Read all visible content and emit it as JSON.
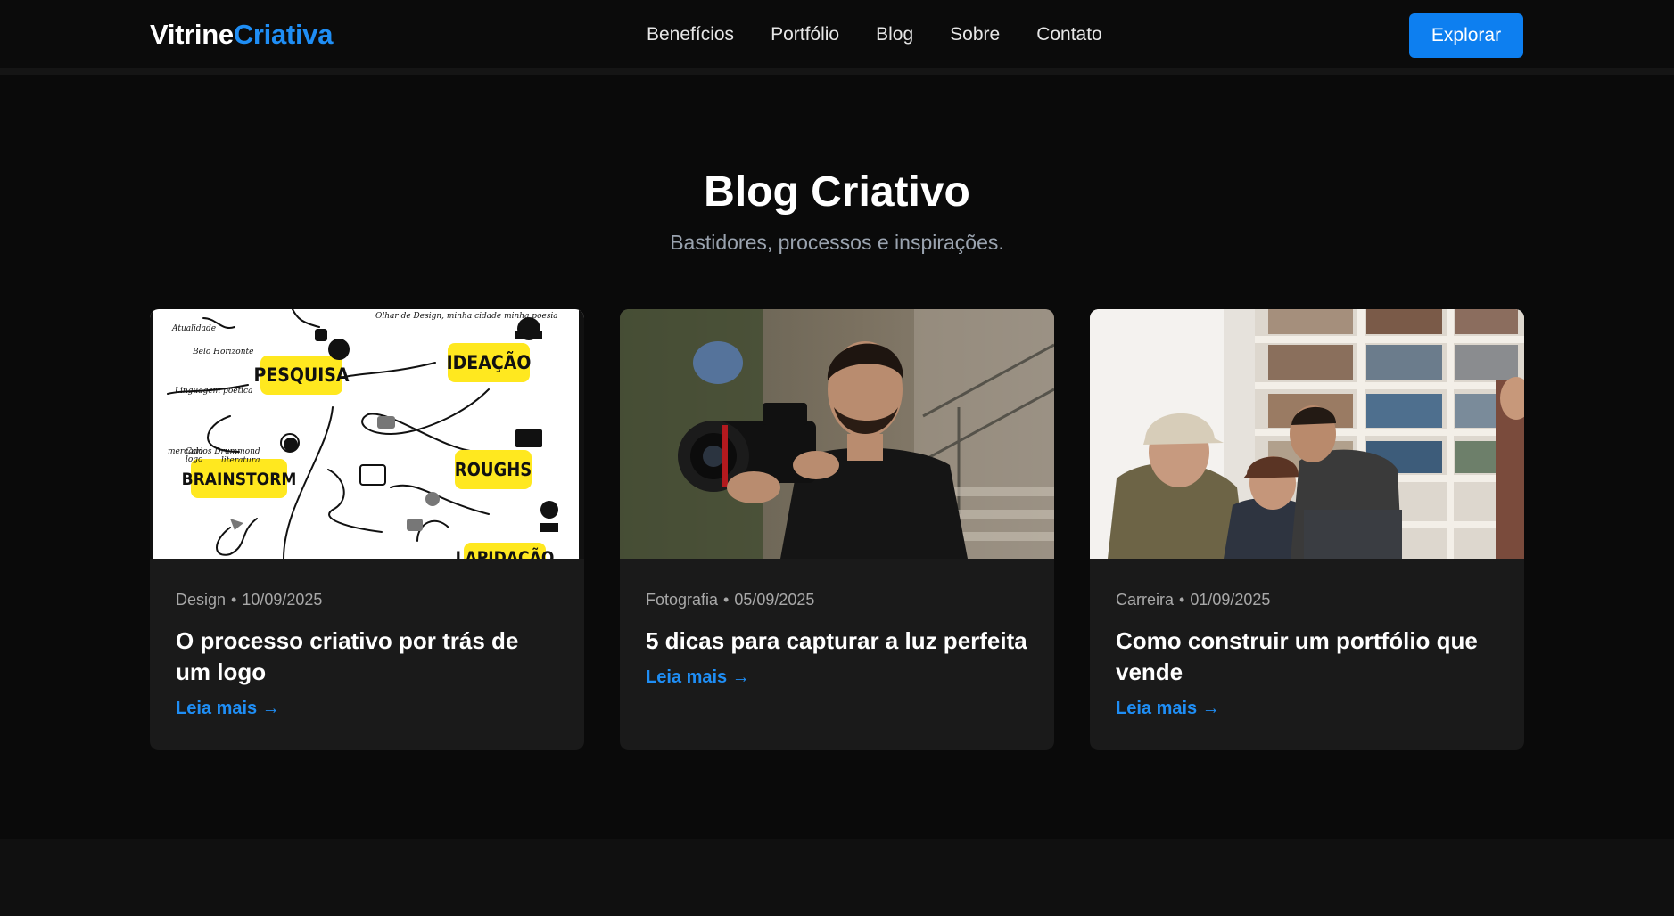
{
  "brand": {
    "part1": "Vitrine",
    "part2": "Criativa"
  },
  "nav": {
    "links": [
      "Benefícios",
      "Portfólio",
      "Blog",
      "Sobre",
      "Contato"
    ],
    "cta": "Explorar"
  },
  "blog": {
    "title": "Blog Criativo",
    "subtitle": "Bastidores, processos e inspirações.",
    "read_more": "Leia mais →",
    "separator": "•",
    "posts": [
      {
        "category": "Design",
        "date": "10/09/2025",
        "title": "O processo criativo por trás de um logo",
        "image_labels": [
          "PESQUISA",
          "IDEAÇÃO",
          "BRAINSTORM",
          "ROUGHS",
          "LAPIDAÇÃO"
        ],
        "image_notes": [
          "Atualidade",
          "Belo Horizonte",
          "Linguagem poética",
          "Olhar de Design, minha cidade minha poesia",
          "Carlos Drummond",
          "literatura",
          "logo",
          "mercado"
        ]
      },
      {
        "category": "Fotografia",
        "date": "05/09/2025",
        "title": "5 dicas para capturar a luz perfeita"
      },
      {
        "category": "Carreira",
        "date": "01/09/2025",
        "title": "Como construir um portfólio que vende"
      }
    ]
  },
  "colors": {
    "accent": "#1f8ef5",
    "button": "#0d7ff0",
    "background": "#0a0a0a",
    "card": "#1a1a1a",
    "sticky_note": "#ffe81f"
  }
}
